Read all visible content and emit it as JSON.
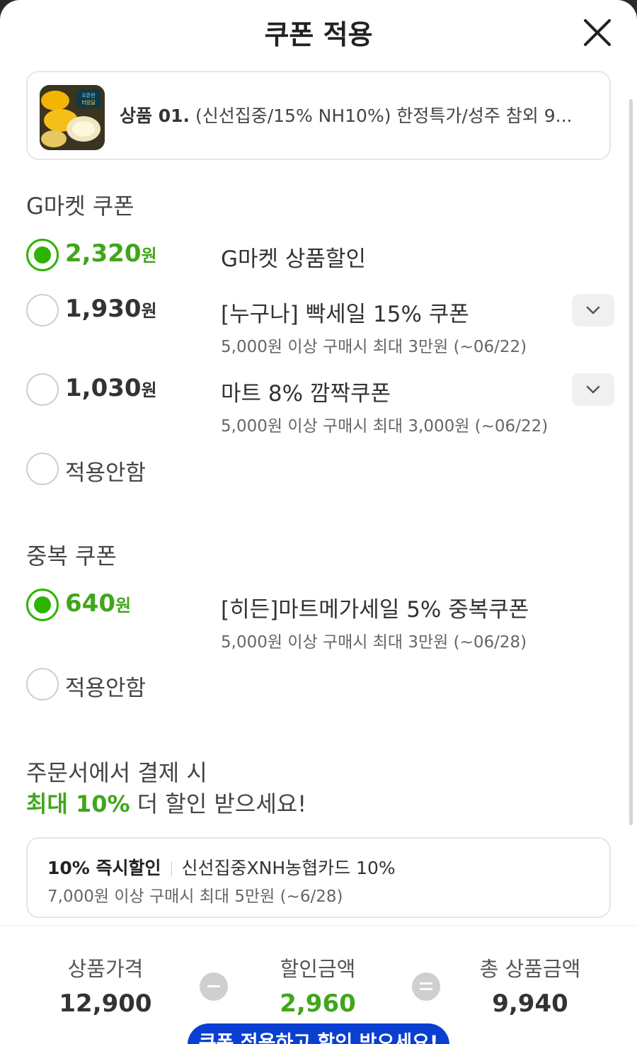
{
  "header": {
    "title": "쿠폰 적용",
    "close_icon": "close-icon"
  },
  "product": {
    "prefix": "상품 01.",
    "name": "(신선집중/15% NH10%) 한정특가/성주 참외 9...",
    "thumb_text": "오픈런 타임딜"
  },
  "gmarket_section": {
    "title": "G마켓 쿠폰",
    "options": [
      {
        "amount": "2,320",
        "won": "원",
        "name": "G마켓 상품할인",
        "desc": "",
        "selected": true
      },
      {
        "amount": "1,930",
        "won": "원",
        "name": "[누구나] 빡세일 15% 쿠폰",
        "desc": "5,000원 이상 구매시 최대 3만원 (~06/22)",
        "selected": false
      },
      {
        "amount": "1,030",
        "won": "원",
        "name": "마트 8% 깜짝쿠폰",
        "desc": "5,000원 이상 구매시 최대 3,000원 (~06/22)",
        "selected": false
      }
    ],
    "none_label": "적용안함"
  },
  "duplicate_section": {
    "title": "중복 쿠폰",
    "options": [
      {
        "amount": "640",
        "won": "원",
        "name": "[히든]마트메가세일 5% 중복쿠폰",
        "desc": "5,000원 이상 구매시 최대 3만원 (~06/28)",
        "selected": true
      }
    ],
    "none_label": "적용안함"
  },
  "promo": {
    "line1": "주문서에서 결제 시",
    "highlight": "최대 10%",
    "line2_rest": " 더 할인 받으세요!"
  },
  "card_offer": {
    "badge": "10% 즉시할인",
    "name": "신선집중XNH농협카드 10%",
    "desc": "7,000원 이상 구매시 최대 5만원 (~6/28)"
  },
  "summary": {
    "price_label": "상품가격",
    "price_value": "12,900",
    "discount_label": "할인금액",
    "discount_value": "2,960",
    "total_label": "총 상품금액",
    "total_value": "9,940",
    "cta_label": "쿠폰 적용하고 할인 받으세요!"
  },
  "colors": {
    "accent_green": "#41a61b",
    "radio_green": "#2db400",
    "cta_blue": "#0a3fd1"
  }
}
